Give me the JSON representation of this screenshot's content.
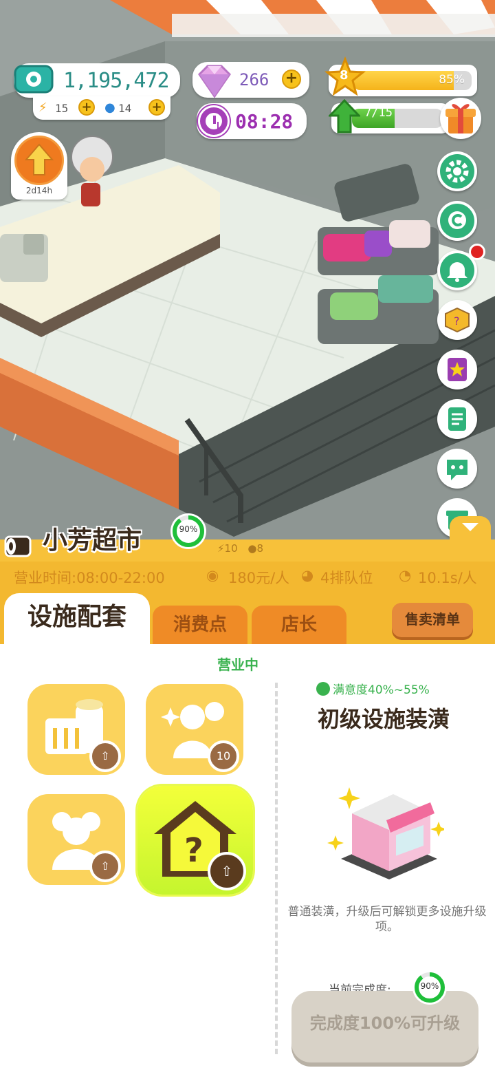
{
  "hud": {
    "cash": "1,195,472",
    "energy": "15",
    "water": "14",
    "gems": "266",
    "timer": "08:28",
    "level": "8",
    "level_progress": "85%",
    "level_progress_value": 0.85,
    "tasks": "7/15",
    "tasks_progress_value": 0.4667,
    "boost_timer": "2d14h"
  },
  "side_buttons": [
    "gear-icon",
    "c-coin-icon",
    "bell-icon",
    "mystery-box-icon",
    "star-book-icon",
    "notes-icon",
    "chat-icon",
    "gift-box-icon"
  ],
  "store": {
    "name": "小芳超市",
    "progress": "90%",
    "energy_stat": "10",
    "water_stat": "8",
    "hours": "营业时间:08:00-22:00",
    "price": "180元/人",
    "queue": "4排队位",
    "speed": "10.1s/人"
  },
  "tabs": {
    "facility": "设施配套",
    "consume": "消费点",
    "manager": "店长",
    "sell_list": "售卖清单"
  },
  "panel": {
    "status": "营业中",
    "tile_2_badge": "10",
    "satisfaction": "满意度40%~55%",
    "facility_title": "初级设施装潢",
    "description": "普通装潢，升级后可解锁更多设施升级项。",
    "complete_label": "当前完成度:",
    "complete_value": "90%",
    "upgrade_button": "完成度100%可升级"
  },
  "colors": {
    "accent_yellow": "#f3b830",
    "tab_orange": "#ef8b26",
    "status_green": "#39b24e",
    "gem_purple": "#7d5ab8",
    "timer_purple": "#9c2fb0"
  }
}
